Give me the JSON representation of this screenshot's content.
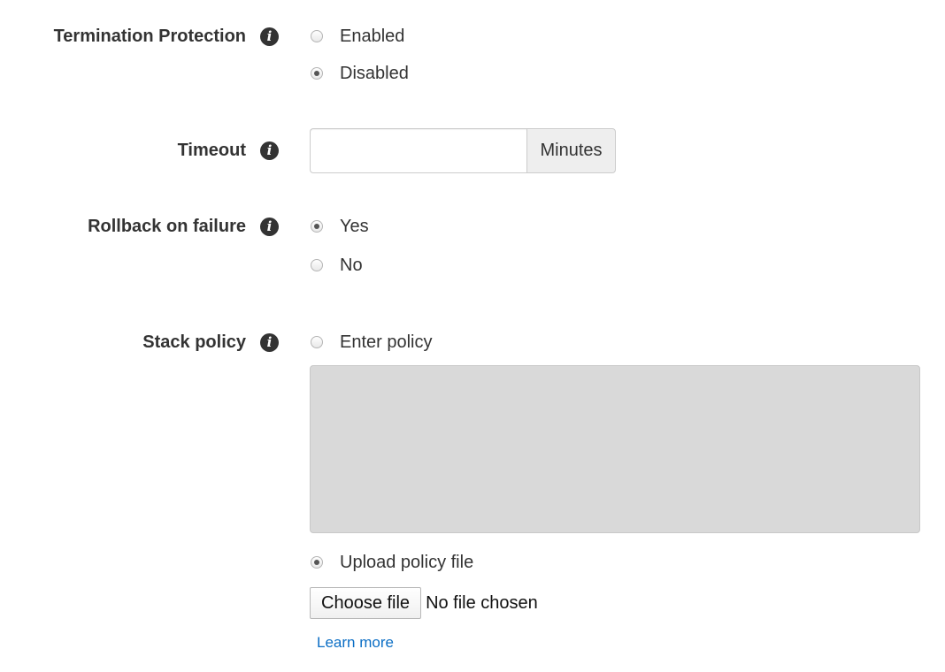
{
  "termination_protection": {
    "label": "Termination Protection",
    "options": [
      {
        "label": "Enabled",
        "checked": false
      },
      {
        "label": "Disabled",
        "checked": true
      }
    ]
  },
  "timeout": {
    "label": "Timeout",
    "value": "",
    "placeholder": "",
    "addon": "Minutes"
  },
  "rollback_on_failure": {
    "label": "Rollback on failure",
    "options": [
      {
        "label": "Yes",
        "checked": true
      },
      {
        "label": "No",
        "checked": false
      }
    ]
  },
  "stack_policy": {
    "label": "Stack policy",
    "enter_policy_label": "Enter policy",
    "enter_policy_checked": false,
    "policy_text": "",
    "upload_label": "Upload policy file",
    "upload_checked": true,
    "choose_file_label": "Choose file",
    "file_status": "No file chosen",
    "learn_more": "Learn more"
  },
  "info_icon_glyph": "i",
  "colors": {
    "link": "#0b6ec5",
    "disabled_textarea": "#d9d9d9",
    "addon_bg": "#eeeeee"
  }
}
